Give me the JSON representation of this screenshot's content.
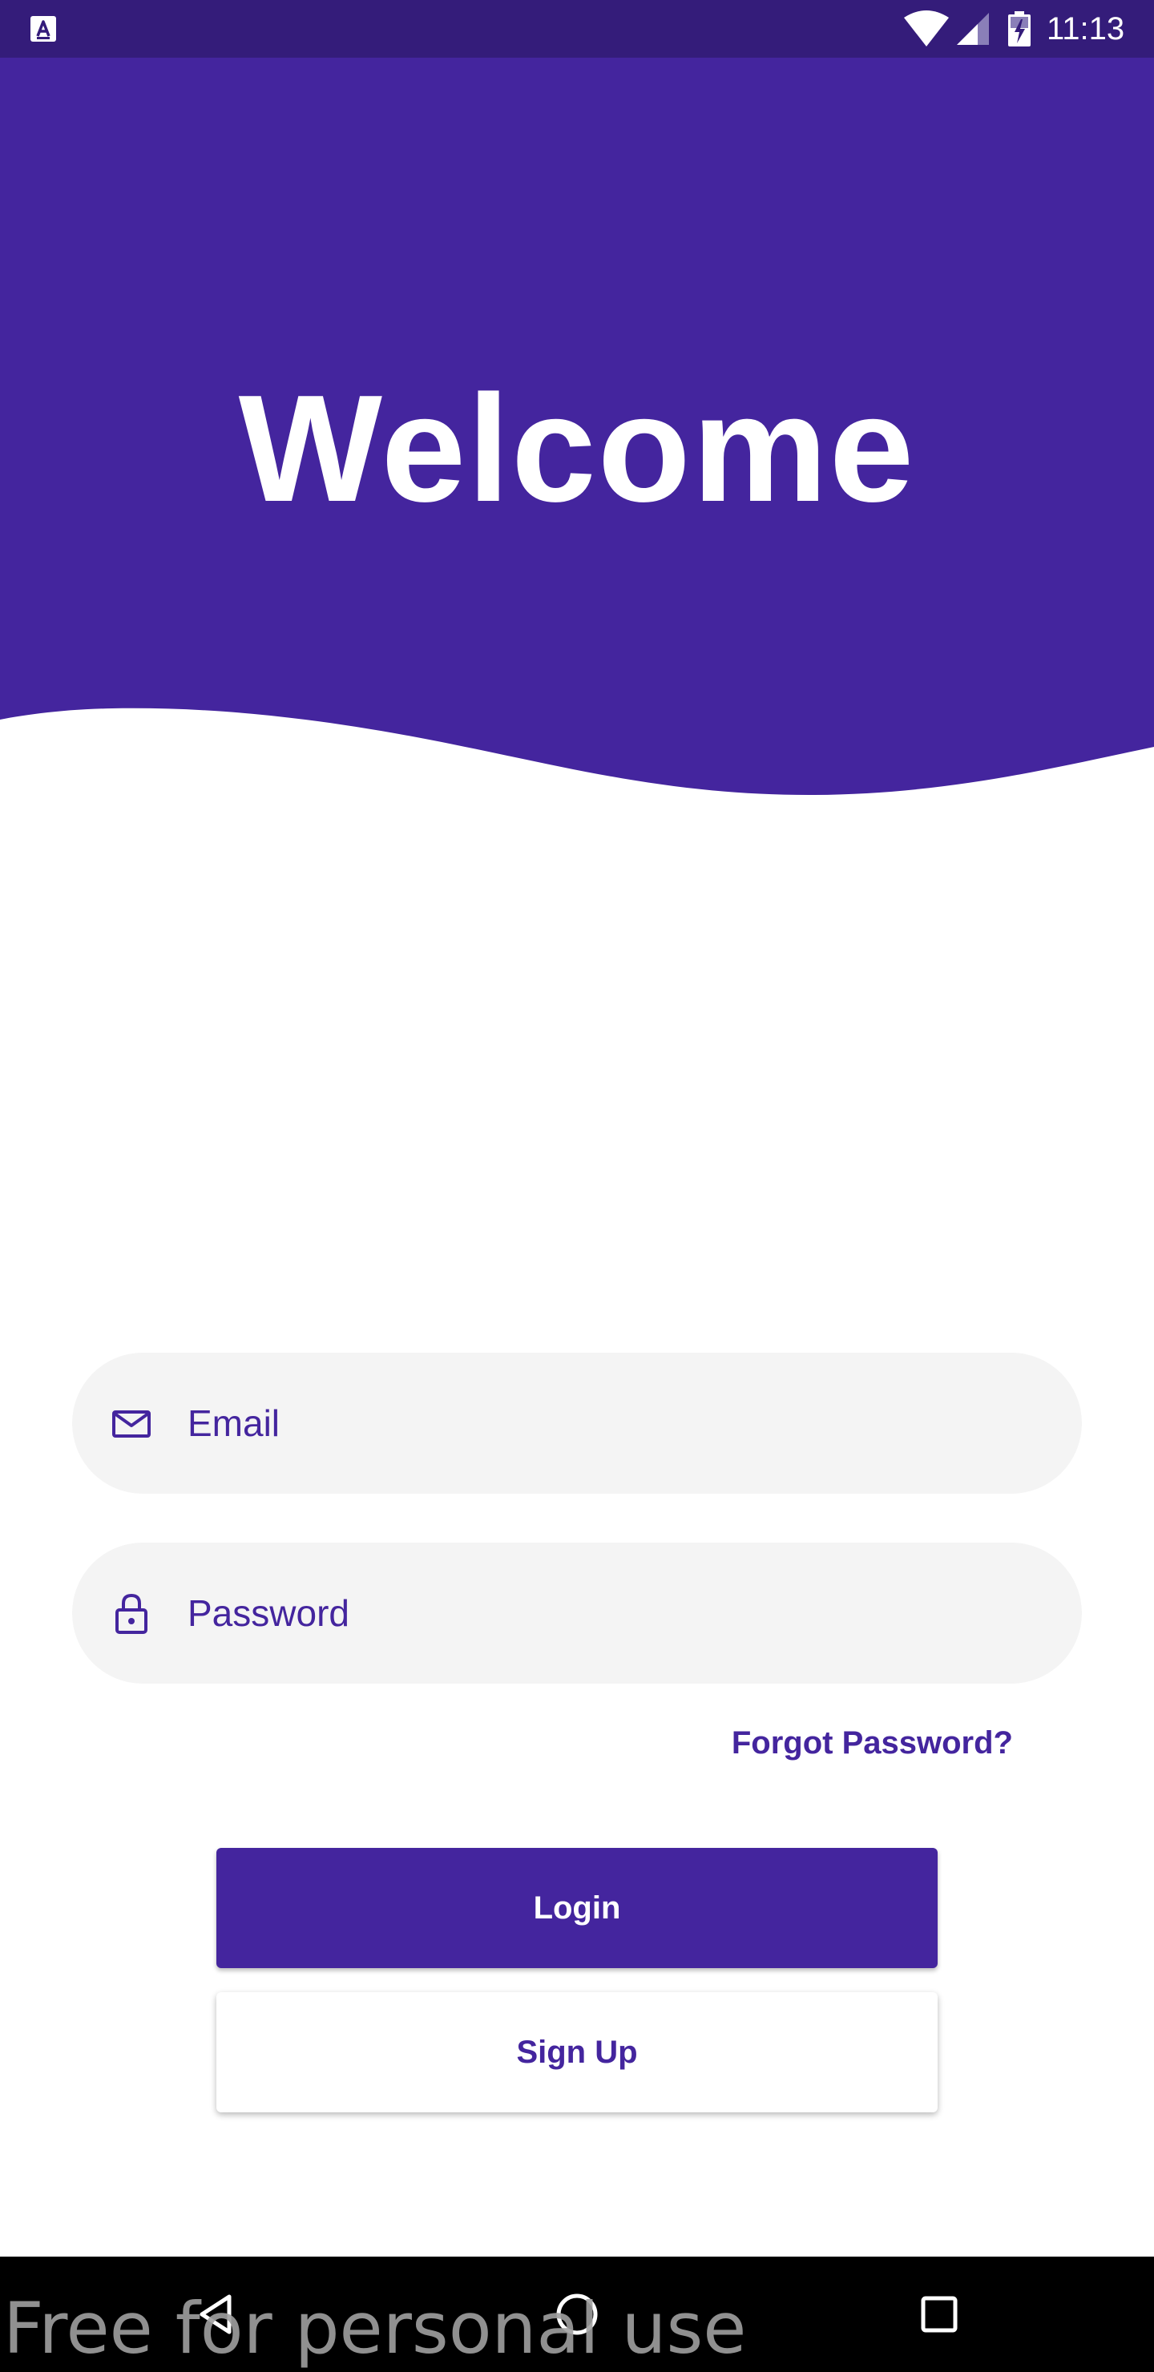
{
  "status_bar": {
    "time": "11:13",
    "icons": [
      "app-notification-icon",
      "wifi-icon",
      "cell-signal-icon",
      "battery-charging-icon"
    ]
  },
  "header": {
    "title": "Welcome",
    "background_color": "#44259e"
  },
  "form": {
    "email": {
      "placeholder": "Email",
      "value": "",
      "icon": "mail-icon"
    },
    "password": {
      "placeholder": "Password",
      "value": "",
      "icon": "lock-icon"
    },
    "forgot_password_label": "Forgot Password?",
    "login_label": "Login",
    "signup_label": "Sign Up"
  },
  "nav_bar": {
    "buttons": [
      "back-icon",
      "home-icon",
      "recents-icon"
    ]
  },
  "watermark": "Free for personal use",
  "colors": {
    "primary": "#44259e",
    "status_bar": "#341c7a",
    "field_background": "#f4f4f4",
    "nav_bar": "#000000"
  }
}
